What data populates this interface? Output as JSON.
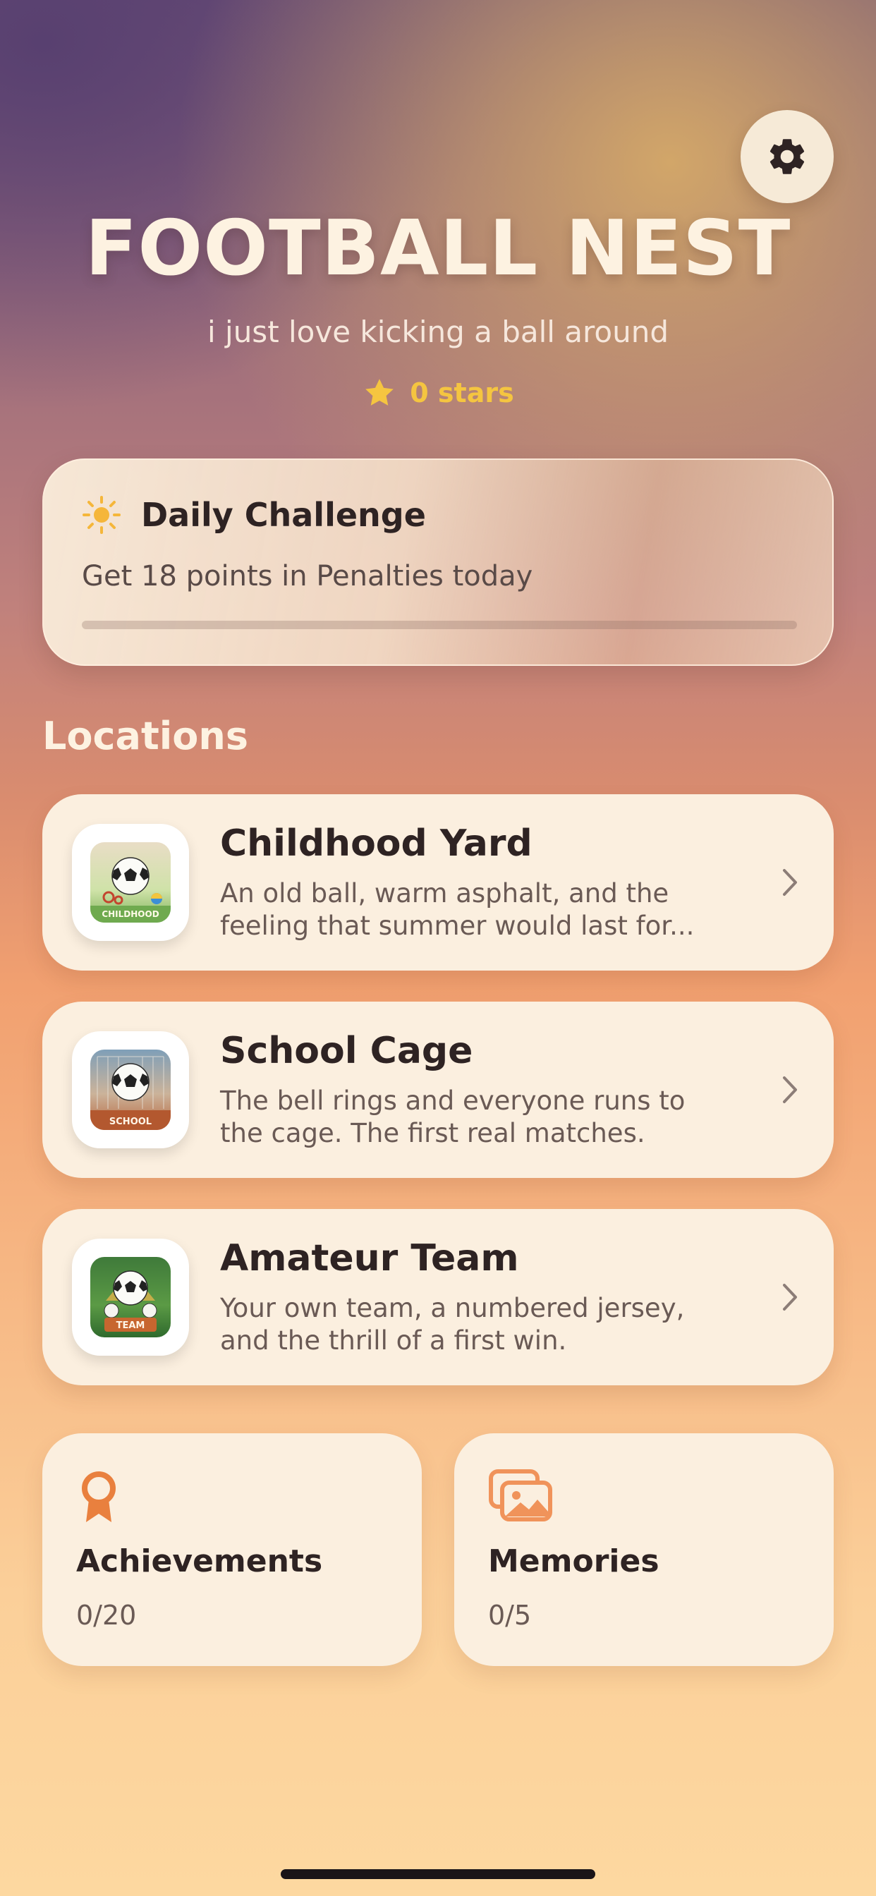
{
  "app": {
    "title": "FOOTBALL NEST",
    "subtitle": "i just love kicking a ball around",
    "stars_label": "0 stars"
  },
  "daily_challenge": {
    "title": "Daily Challenge",
    "description": "Get 18 points in Penalties today",
    "progress": 0
  },
  "locations": {
    "section_title": "Locations",
    "items": [
      {
        "name": "Childhood Yard",
        "description": "An old ball, warm asphalt, and the feeling that summer would last for...",
        "thumb_label": "CHILDHOOD"
      },
      {
        "name": "School Cage",
        "description": "The bell rings and everyone runs to the cage. The first real matches.",
        "thumb_label": "SCHOOL"
      },
      {
        "name": "Amateur Team",
        "description": "Your own team, a numbered jersey, and the thrill of a first win.",
        "thumb_label": "TEAM"
      }
    ]
  },
  "stats": {
    "achievements": {
      "title": "Achievements",
      "value": "0/20",
      "icon": "ribbon-award-icon"
    },
    "memories": {
      "title": "Memories",
      "value": "0/5",
      "icon": "photos-icon"
    }
  },
  "icons": {
    "settings": "gear-icon",
    "star": "star-icon",
    "sun": "sun-icon",
    "chevron": "chevron-right-icon"
  },
  "colors": {
    "accent_orange": "#e9803e",
    "star_yellow": "#f5c540",
    "card_bg": "#fbefdf",
    "text_dark": "#2e2323"
  }
}
